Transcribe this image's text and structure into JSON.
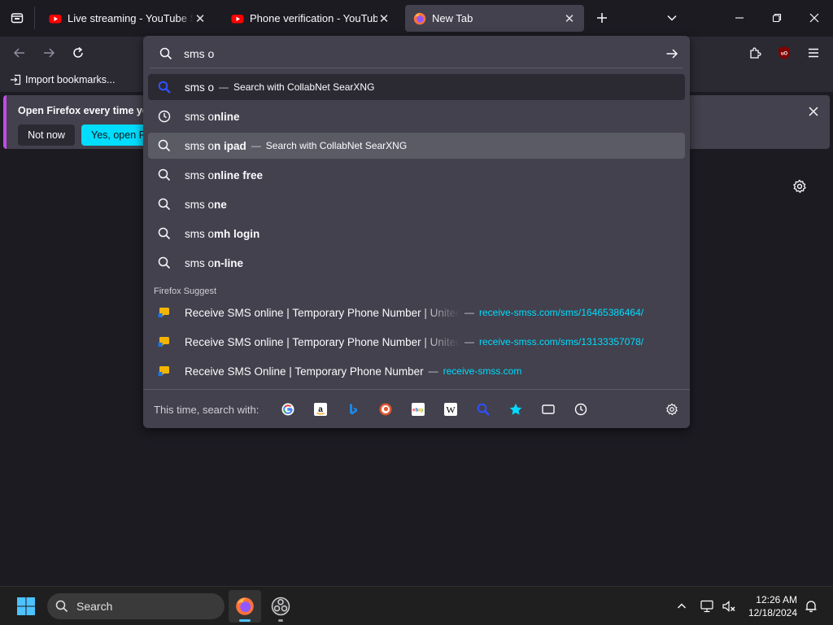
{
  "tabs": [
    {
      "title": "Live streaming - YouTube Studio",
      "favicon": "youtube-icon"
    },
    {
      "title": "Phone verification - YouTube",
      "favicon": "youtube-icon"
    },
    {
      "title": "New Tab",
      "favicon": "firefox-icon",
      "active": true
    }
  ],
  "bookmarks": {
    "import_label": "Import bookmarks..."
  },
  "notification": {
    "text": "Open Firefox every time you",
    "not_now": "Not now",
    "yes_open": "Yes, open Firefox"
  },
  "urlbar": {
    "value": "sms o"
  },
  "suggestions": [
    {
      "typed": "sms o",
      "rest": "",
      "action": "Search with CollabNet SearXNG",
      "icon": "searxng-icon",
      "highlight": "selected"
    },
    {
      "typed": "sms o",
      "rest": "nline",
      "action": "",
      "icon": "history-clock-icon"
    },
    {
      "typed": "sms o",
      "rest": "n ipad",
      "action": "Search with CollabNet SearXNG",
      "icon": "search-icon",
      "highlight": "hover"
    },
    {
      "typed": "sms o",
      "rest": "nline free",
      "action": "",
      "icon": "search-icon"
    },
    {
      "typed": "sms o",
      "rest": "ne",
      "action": "",
      "icon": "search-icon"
    },
    {
      "typed": "sms o",
      "rest": "mh login",
      "action": "",
      "icon": "search-icon"
    },
    {
      "typed": "sms o",
      "rest": "n-line",
      "action": "",
      "icon": "search-icon"
    }
  ],
  "firefox_suggest": {
    "label": "Firefox Suggest",
    "items": [
      {
        "title": "Receive SMS online | Temporary Phone Number | United States",
        "url": "receive-smss.com/sms/16465386464/"
      },
      {
        "title": "Receive SMS online | Temporary Phone Number | United States",
        "url": "receive-smss.com/sms/13133357078/"
      },
      {
        "title": "Receive SMS Online | Temporary Phone Number",
        "url": "receive-smss.com"
      }
    ]
  },
  "one_off": {
    "label": "This time, search with:",
    "engines": [
      "google-icon",
      "amazon-icon",
      "bing-icon",
      "duckduckgo-icon",
      "ebay-icon",
      "wikipedia-icon",
      "searxng-icon",
      "bookmarks-star-icon",
      "tabs-icon",
      "history-clock-icon"
    ]
  },
  "taskbar": {
    "search_label": "Search",
    "time": "12:26 AM",
    "date": "12/18/2024"
  },
  "colors": {
    "accent": "#00ddff",
    "notification_stripe": "#c14be5",
    "youtube_red": "#ff0000"
  }
}
